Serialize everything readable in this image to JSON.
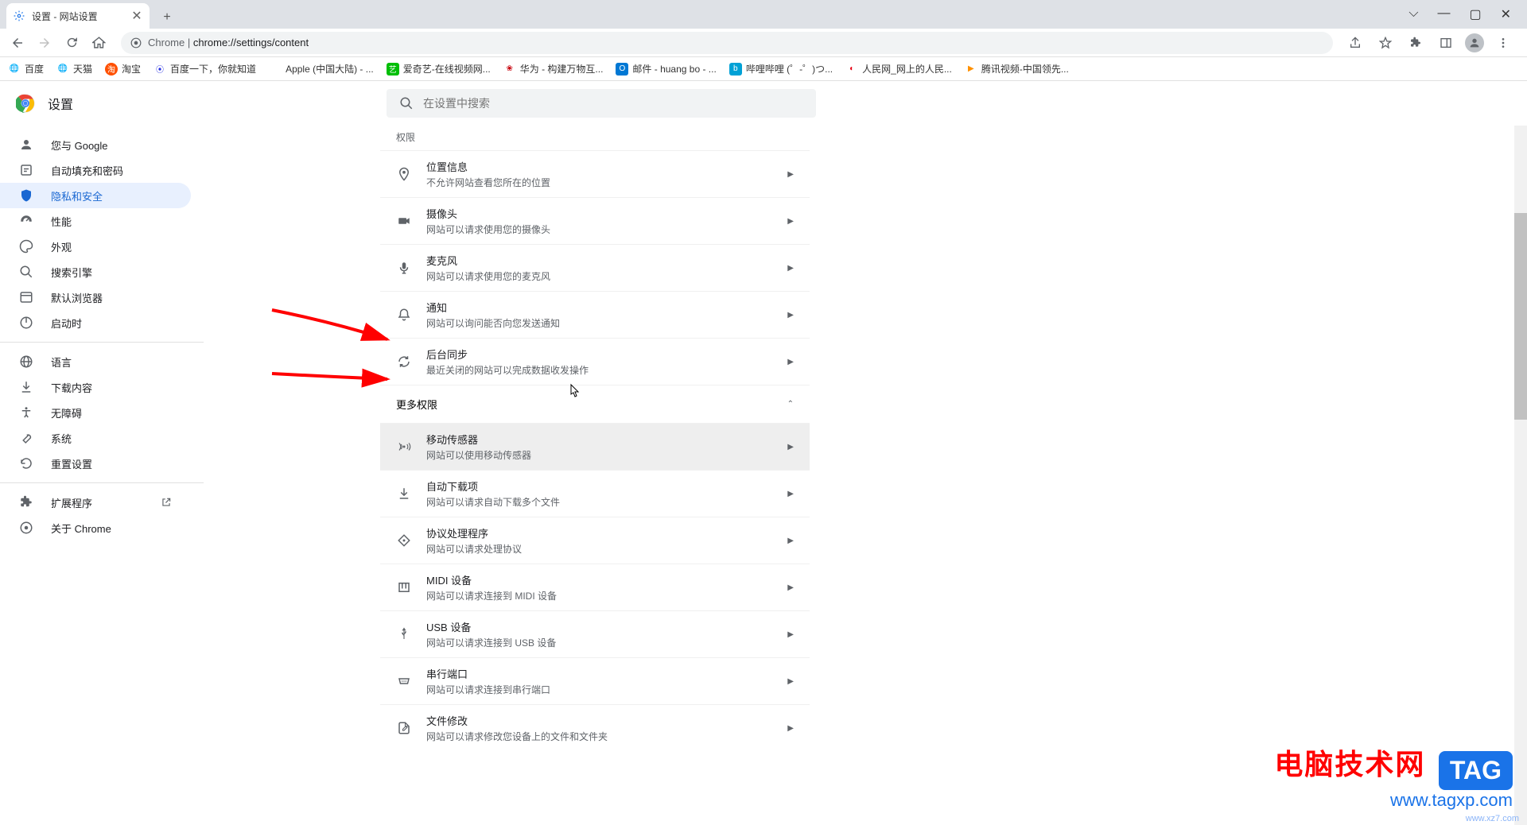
{
  "tab": {
    "title": "设置 - 网站设置"
  },
  "address": {
    "prefix": "Chrome",
    "sep": " | ",
    "url": "chrome://settings/content"
  },
  "bookmarks": [
    {
      "label": "百度"
    },
    {
      "label": "天猫"
    },
    {
      "label": "淘宝"
    },
    {
      "label": "百度一下，你就知道"
    },
    {
      "label": "Apple (中国大陆) - ..."
    },
    {
      "label": "爱奇艺-在线视频网..."
    },
    {
      "label": "华为 - 构建万物互..."
    },
    {
      "label": "邮件 - huang bo - ..."
    },
    {
      "label": "哔哩哔哩 (゜-゜)つ..."
    },
    {
      "label": "人民网_网上的人民..."
    },
    {
      "label": "腾讯视频-中国领先..."
    }
  ],
  "header": {
    "title": "设置",
    "search_placeholder": "在设置中搜索"
  },
  "sidebar": {
    "items": [
      {
        "label": "您与 Google"
      },
      {
        "label": "自动填充和密码"
      },
      {
        "label": "隐私和安全"
      },
      {
        "label": "性能"
      },
      {
        "label": "外观"
      },
      {
        "label": "搜索引擎"
      },
      {
        "label": "默认浏览器"
      },
      {
        "label": "启动时"
      }
    ],
    "items2": [
      {
        "label": "语言"
      },
      {
        "label": "下载内容"
      },
      {
        "label": "无障碍"
      },
      {
        "label": "系统"
      },
      {
        "label": "重置设置"
      }
    ],
    "items3": [
      {
        "label": "扩展程序"
      },
      {
        "label": "关于 Chrome"
      }
    ]
  },
  "section1_label": "权限",
  "permissions": [
    {
      "title": "位置信息",
      "sub": "不允许网站查看您所在的位置"
    },
    {
      "title": "摄像头",
      "sub": "网站可以请求使用您的摄像头"
    },
    {
      "title": "麦克风",
      "sub": "网站可以请求使用您的麦克风"
    },
    {
      "title": "通知",
      "sub": "网站可以询问能否向您发送通知"
    },
    {
      "title": "后台同步",
      "sub": "最近关闭的网站可以完成数据收发操作"
    }
  ],
  "more_permissions_label": "更多权限",
  "more_permissions": [
    {
      "title": "移动传感器",
      "sub": "网站可以使用移动传感器"
    },
    {
      "title": "自动下载项",
      "sub": "网站可以请求自动下载多个文件"
    },
    {
      "title": "协议处理程序",
      "sub": "网站可以请求处理协议"
    },
    {
      "title": "MIDI 设备",
      "sub": "网站可以请求连接到 MIDI 设备"
    },
    {
      "title": "USB 设备",
      "sub": "网站可以请求连接到 USB 设备"
    },
    {
      "title": "串行端口",
      "sub": "网站可以请求连接到串行端口"
    },
    {
      "title": "文件修改",
      "sub": "网站可以请求修改您设备上的文件和文件夹"
    }
  ],
  "watermark": {
    "main": "电脑技术网",
    "url": "www.tagxp.com",
    "tag": "TAG",
    "small": "www.xz7.com"
  }
}
